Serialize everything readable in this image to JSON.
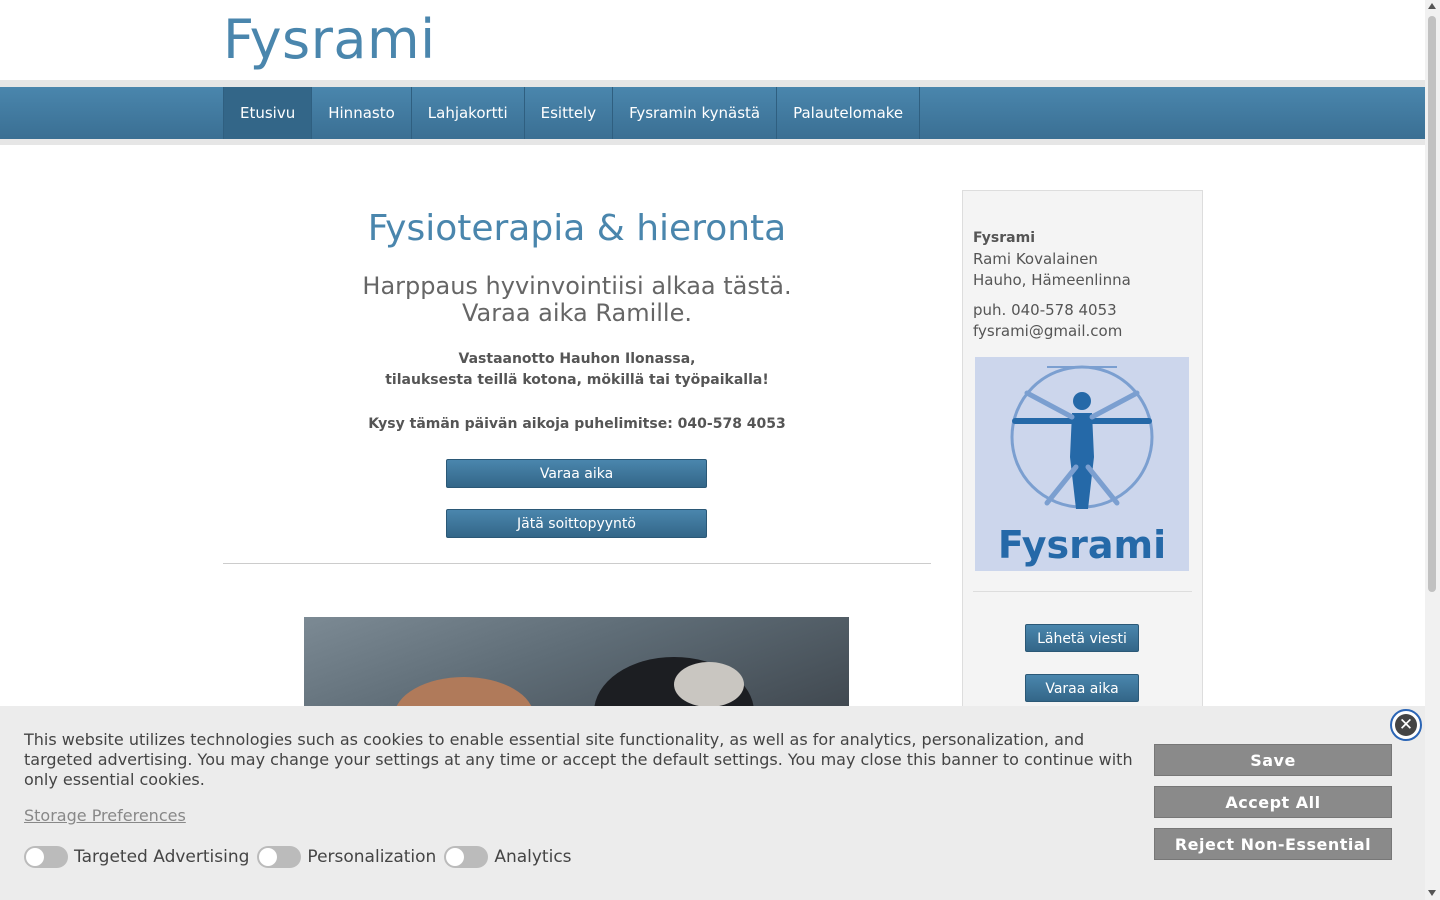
{
  "site": {
    "title": "Fysrami"
  },
  "nav": {
    "items": [
      {
        "label": "Etusivu"
      },
      {
        "label": "Hinnasto"
      },
      {
        "label": "Lahjakortti"
      },
      {
        "label": "Esittely"
      },
      {
        "label": "Fysramin kynästä"
      },
      {
        "label": "Palautelomake"
      }
    ],
    "active": "Etusivu"
  },
  "main": {
    "heading": "Fysioterapia & hieronta",
    "subheading_line1": "Harppaus hyvinvointiisi alkaa tästä.",
    "subheading_line2": "Varaa aika Ramille.",
    "info_line1": "Vastaanotto Hauhon Ilonassa,",
    "info_line2": "tilauksesta teillä kotona, mökillä tai työpaikalla!",
    "call_text": "Kysy tämän päivän aikoja puhelimitse: 040-578 4053",
    "book_button": "Varaa aika",
    "callback_button": "Jätä soittopyyntö"
  },
  "sidebar": {
    "company": "Fysrami",
    "person": "Rami Kovalainen",
    "location": "Hauho, Hämeenlinna",
    "phone": "puh. 040-578 4053",
    "email": "fysrami@gmail.com",
    "logo_text": "Fysrami",
    "message_button": "Lähetä viesti",
    "book_button": "Varaa aika"
  },
  "cookie": {
    "text": "This website utilizes technologies such as cookies to enable essential site functionality, as well as for analytics, personalization, and targeted advertising. You may change your settings at any time or accept the default settings. You may close this banner to continue with only essential cookies.",
    "storage_link": "Storage Preferences",
    "toggles": [
      {
        "label": "Targeted Advertising",
        "on": false
      },
      {
        "label": "Personalization",
        "on": false
      },
      {
        "label": "Analytics",
        "on": false
      }
    ],
    "save": "Save",
    "accept": "Accept All",
    "reject": "Reject Non-Essential",
    "close_glyph": "✕"
  },
  "colors": {
    "brand": "#4a86ad",
    "nav_dark": "#336688",
    "logo_bg": "#ccd6ec",
    "cookie_button": "#8a8a8a"
  }
}
